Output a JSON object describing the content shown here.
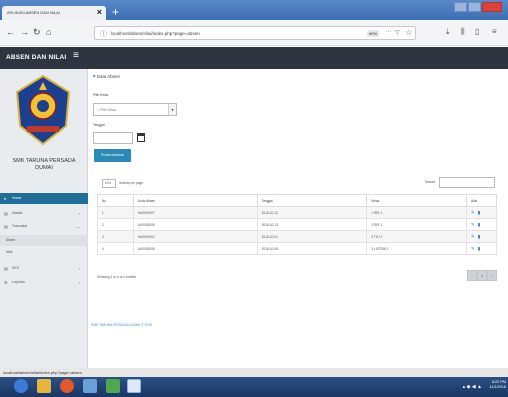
{
  "browser": {
    "tab_title": "APLIKASI ABSEN DAN NILAI",
    "tab_close": "×",
    "new_tab": "+",
    "url": "localhost/absen/nilai/index.php?page=absen",
    "zoom": "80%",
    "url_dots": "···"
  },
  "app": {
    "brand": "ABSEN DAN NILAI",
    "menu_icon": "≡"
  },
  "sidebar": {
    "school_name_line1": "SMK TARUNA PERSADA",
    "school_name_line2": "DUMAI",
    "items": [
      {
        "label": "Home",
        "icon": "home-icon"
      },
      {
        "label": "Master",
        "icon": "folder-icon"
      },
      {
        "label": "Transaksi",
        "icon": "folder-icon"
      },
      {
        "label": "Absen"
      },
      {
        "label": "Nilai"
      },
      {
        "label": "SKS",
        "icon": "folder-icon"
      },
      {
        "label": "Laporan",
        "icon": "list-icon"
      }
    ]
  },
  "main": {
    "title": "Data Absen",
    "kelas_label": "Pilih Kelas",
    "kelas_placeholder": "--Pilih Kelas--",
    "tanggal_label": "Tanggal",
    "process_button": "Proses Absensi",
    "length_value": "10",
    "length_label": "records per page",
    "search_label": "Search:",
    "columns": [
      "No",
      "Kode Absen",
      "Tanggal",
      "Kelas",
      "Aksi"
    ],
    "rows": [
      {
        "no": "1",
        "kode": "KA0000007",
        "tanggal": "2018-10-12",
        "kelas": "1 RPL 1"
      },
      {
        "no": "2",
        "kode": "KA0000008",
        "tanggal": "2018-10-13",
        "kelas": "1 RPL 1"
      },
      {
        "no": "3",
        "kode": "KA0000002",
        "tanggal": "2018-10-01",
        "kelas": "3 TKJ 1"
      },
      {
        "no": "4",
        "kode": "KA0000008",
        "tanggal": "2018-10-08",
        "kelas": "3 LISTRIK 1"
      }
    ],
    "info": "Showing 1 to 4 of 4 entries",
    "pager": [
      "‹",
      "1",
      "›"
    ],
    "footer": "SMK TARUNA PERSADA DUMAI © 2018"
  },
  "statusbar": {
    "url": "localhost/absen/nilai/index.php?page=absen"
  },
  "taskbar": {
    "time": "8:22 PM",
    "date": "11/1/2018"
  },
  "colors": {
    "header": "#2e3440",
    "accent": "#1e6e99",
    "button": "#2a8ab5",
    "taskbar": "#1a3764"
  }
}
